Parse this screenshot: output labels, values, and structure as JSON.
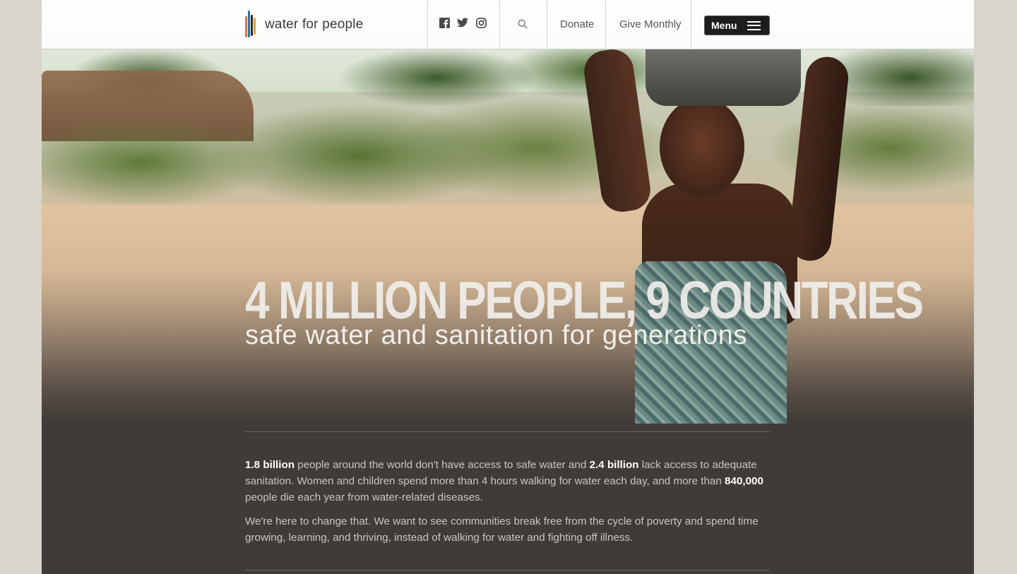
{
  "header": {
    "logo_text": "water for people",
    "social": [
      {
        "icon": "facebook-icon"
      },
      {
        "icon": "twitter-icon"
      },
      {
        "icon": "instagram-icon"
      }
    ],
    "search_icon": "search-icon",
    "donate_label": "Donate",
    "give_monthly_label": "Give Monthly",
    "menu_label": "Menu"
  },
  "hero": {
    "headline": "4 MILLION PEOPLE, 9 COUNTRIES",
    "subhead": "safe water and sanitation for generations"
  },
  "intro": {
    "p1": {
      "s1_bold": "1.8 billion",
      "s2": " people around the world don't have access to safe water and ",
      "s3_bold": "2.4 billion",
      "s4": " lack access to adequate sanitation. Women and children spend more than 4 hours walking for water each day, and more than ",
      "s5_bold": "840,000",
      "s6": " people die each year from water-related diseases."
    },
    "p2": "We're here to change that. We want to see communities break free from the cycle of poverty and spend time growing, learning, and thriving, instead of walking for water and fighting off illness."
  },
  "colors": {
    "page_bg": "#d8d5cc",
    "content_bg": "#3f3b37",
    "menu_bg": "#1d1d1d"
  }
}
